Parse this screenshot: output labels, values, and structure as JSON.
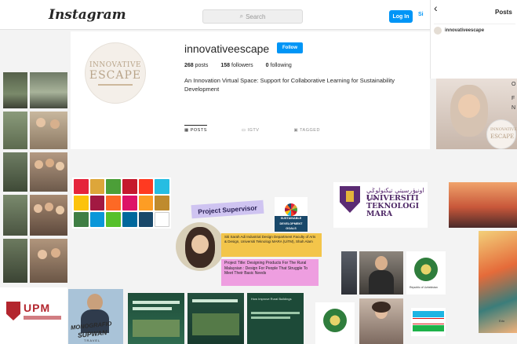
{
  "topbar": {
    "logo": "Instagram",
    "search_placeholder": "Search",
    "login_label": "Log In",
    "signup_label": "Si"
  },
  "profile": {
    "avatar_line1": "INNOVATIVE",
    "avatar_line2": "ESCAPE",
    "username": "innovativeescape",
    "follow_label": "Follow",
    "posts_count": "268",
    "posts_label": "posts",
    "followers_count": "158",
    "followers_label": "followers",
    "following_count": "0",
    "following_label": "following",
    "bio": "An Innovation Virtual Space: Support for Collaborative Learning for Sustainability Development"
  },
  "tabs": [
    {
      "label": "POSTS"
    },
    {
      "label": "IGTV"
    },
    {
      "label": "TAGGED"
    }
  ],
  "right_panel": {
    "back": "‹",
    "title": "Posts",
    "username": "innovativeescape",
    "avatar_line1": "INNOVATIVE",
    "avatar_line2": "ESCAPE",
    "edge_letter_1": "O",
    "edge_letter_2": "F",
    "edge_letter_3": "N"
  },
  "collage": {
    "uitm_jawi": "اونيۏرسيتي تيکنولوݢي مارا",
    "uitm_line1": "UNIVERSITI",
    "uitm_line2": "TEKNOLOGI",
    "uitm_line3": "MARA",
    "project_supervisor": "Project Supervisor",
    "sdg_line1": "SUSTAINABLE",
    "sdg_line2": "DEVELOPMENT",
    "sdg_line3": "GOALS",
    "supervisor_details": "Siti Sarah Adi Industrial Design Department Faculty of Arts & Design, Universiti Teknologi MARA (UiTM), Shah Alam",
    "project_title": "Project Title: Designing Products For The Rural Malaysian : Design For People That Struggle To Meet Their Basic Needs",
    "upm_text": "UPM",
    "mono_line1": "MONOGRAFIO",
    "mono_line2": "SUPWAN",
    "mono_line3": "TRAVEL",
    "green_post_title": "How Improve Rural Buildings",
    "seal_caption": "Republic of Uzbekistan",
    "edge_caption": "Edo"
  }
}
